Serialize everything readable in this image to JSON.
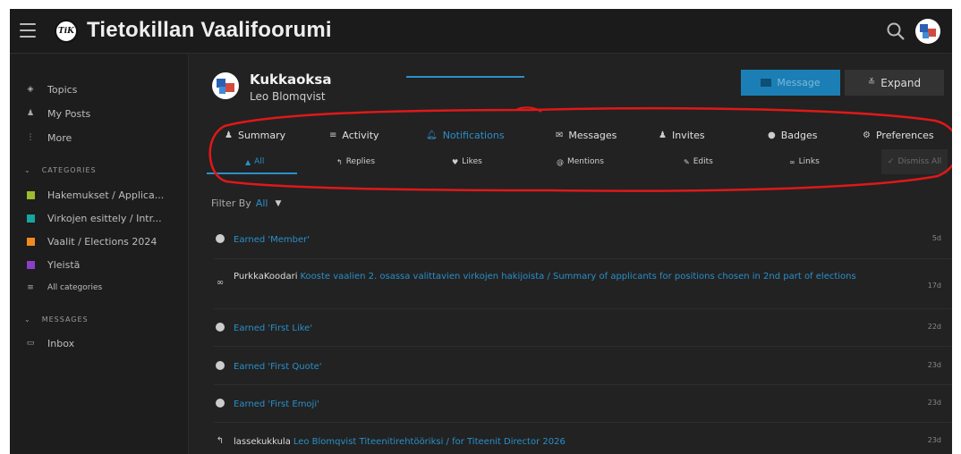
{
  "header": {
    "site_title": "Tietokillan Vaalifoorumi",
    "logo_text": "TiK"
  },
  "sidebar": {
    "nav": [
      {
        "label": "Topics",
        "icon": "layers-icon"
      },
      {
        "label": "My Posts",
        "icon": "user-icon"
      },
      {
        "label": "More",
        "icon": "more-icon"
      }
    ],
    "categories_heading": "CATEGORIES",
    "categories": [
      {
        "label": "Hakemukset / Applica...",
        "color": "#9dbb2d"
      },
      {
        "label": "Virkojen esittely / Intr...",
        "color": "#14a7a0"
      },
      {
        "label": "Vaalit / Elections 2024",
        "color": "#f28a1c"
      },
      {
        "label": "Yleistä",
        "color": "#8a3fc7"
      }
    ],
    "all_categories": "All categories",
    "messages_heading": "MESSAGES",
    "inbox": "Inbox"
  },
  "profile": {
    "title": "Kukkaoksa",
    "name": "Leo Blomqvist",
    "message_button": "Message",
    "expand_button": "Expand"
  },
  "tabs": [
    "Summary",
    "Activity",
    "Notifications",
    "Messages",
    "Invites",
    "Badges",
    "Preferences"
  ],
  "active_tab": "Notifications",
  "subtabs": [
    "All",
    "Replies",
    "Likes",
    "Mentions",
    "Edits",
    "Links"
  ],
  "active_subtab": "All",
  "dismiss_all": "Dismiss All",
  "filter": {
    "label": "Filter By",
    "value": "All"
  },
  "notifications": [
    {
      "user": "",
      "text": "Earned 'Member'",
      "age": "5d",
      "icon": "badge-icon"
    },
    {
      "user": "PurkkaKoodari",
      "text": "Kooste vaalien 2. osassa valittavien virkojen hakijoista / Summary of applicants for positions chosen in 2nd part of elections",
      "age": "17d",
      "icon": "link-icon"
    },
    {
      "user": "",
      "text": "Earned 'First Like'",
      "age": "22d",
      "icon": "badge-icon"
    },
    {
      "user": "",
      "text": "Earned 'First Quote'",
      "age": "23d",
      "icon": "badge-icon"
    },
    {
      "user": "",
      "text": "Earned 'First Emoji'",
      "age": "23d",
      "icon": "badge-icon"
    },
    {
      "user": "lassekukkula",
      "text": "Leo Blomqvist Titeenitirehtööriksi / for Titeenit Director 2026",
      "age": "23d",
      "icon": "reply-icon"
    }
  ],
  "colors": {
    "accent": "#2a8fc9",
    "annotation": "#e01818",
    "background": "#222222"
  }
}
